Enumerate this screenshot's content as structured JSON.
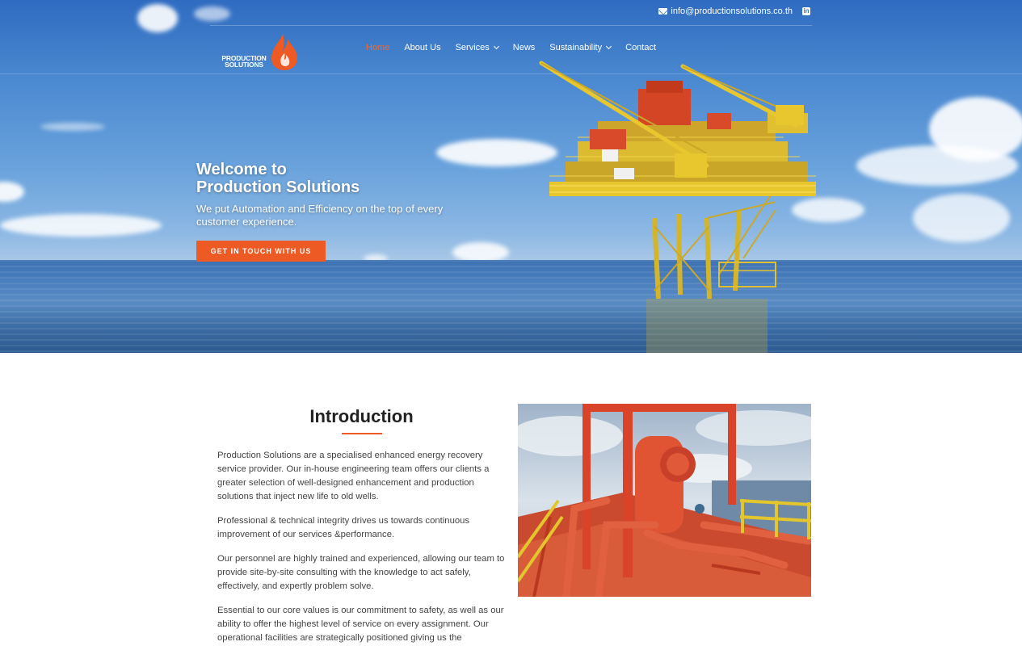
{
  "topbar": {
    "email": "info@productionsolutions.co.th",
    "mail_icon": "envelope-icon",
    "social_icon": "linkedin-icon"
  },
  "logo": {
    "line1": "PRODUCTION",
    "line2": "SOLUTIONS",
    "icon": "flame-drop-icon"
  },
  "nav": {
    "items": [
      {
        "label": "Home",
        "active": true,
        "dropdown": false
      },
      {
        "label": "About Us",
        "active": false,
        "dropdown": false
      },
      {
        "label": "Services",
        "active": false,
        "dropdown": true
      },
      {
        "label": "News",
        "active": false,
        "dropdown": false
      },
      {
        "label": "Sustainability",
        "active": false,
        "dropdown": true
      },
      {
        "label": "Contact",
        "active": false,
        "dropdown": false
      }
    ]
  },
  "hero": {
    "title_line1": "Welcome to",
    "title_line2": "Production Solutions",
    "subtitle": "We put Automation and Efficiency on the top of every customer experience.",
    "cta_label": "GET IN TOUCH WITH US"
  },
  "intro": {
    "title": "Introduction",
    "paragraphs": [
      "Production Solutions are a specialised enhanced energy recovery service provider. Our in-house engineering team offers our clients a greater selection of well-designed enhancement and production solutions that inject new life to old wells.",
      "Professional & technical integrity drives us towards continuous improvement of our services &performance.",
      "Our personnel are highly trained and experienced, allowing our team to provide site-by-site consulting with the knowledge to act safely, effectively, and expertly problem solve.",
      "Essential to our core values is our commitment to safety, as well as our ability to offer the highest level of service on every assignment. Our operational facilities are strategically positioned giving us the"
    ]
  },
  "colors": {
    "accent": "#ee5a24",
    "active_nav": "#ee6b34",
    "text": "#444444"
  }
}
